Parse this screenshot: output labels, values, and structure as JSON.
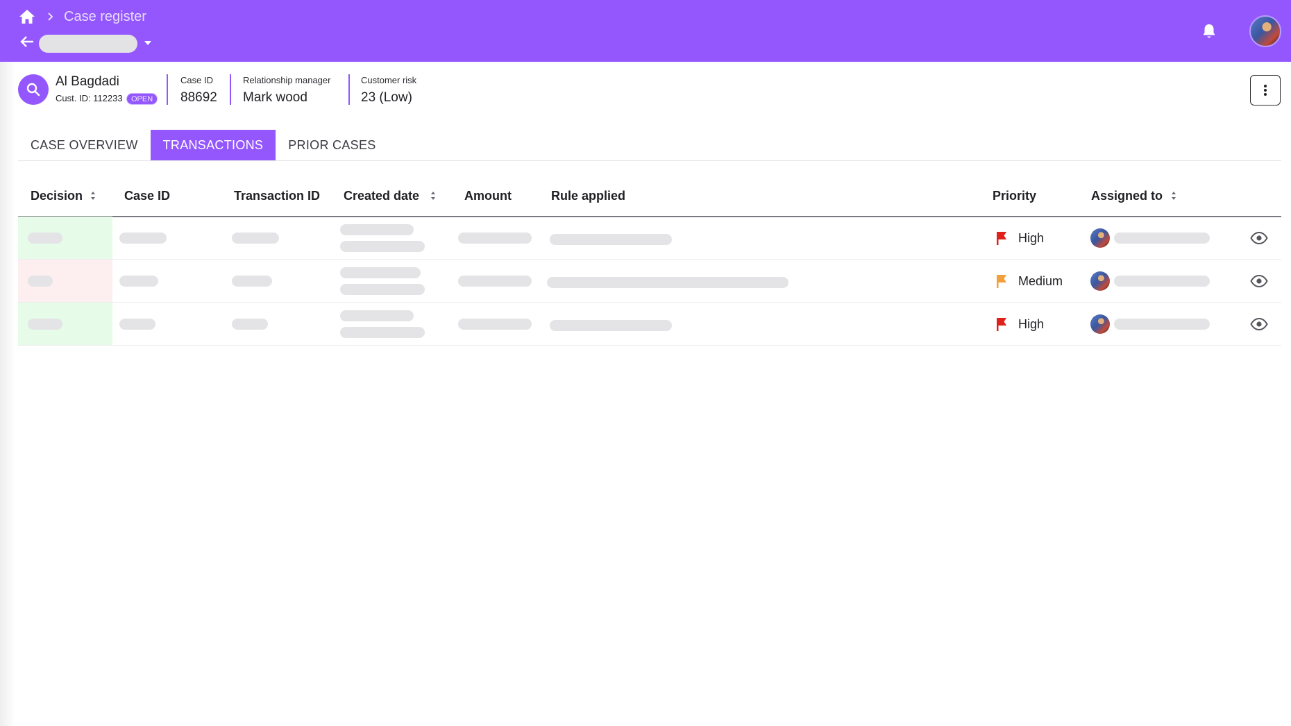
{
  "topbar": {
    "breadcrumb": "Case register",
    "icons": [
      "home-icon",
      "chevron-right-icon",
      "back-arrow-icon",
      "caret-down-icon",
      "bell-icon"
    ]
  },
  "case_header": {
    "customer_name": "Al Bagdadi",
    "customer_id_label": "Cust. ID: 112233",
    "status": "OPEN",
    "case_id_label": "Case ID",
    "case_id_value": "88692",
    "rm_label": "Relationship manager",
    "rm_value": "Mark wood",
    "risk_label": "Customer risk",
    "risk_value": "23 (Low)"
  },
  "tabs": [
    {
      "label": "CASE OVERVIEW",
      "active": false
    },
    {
      "label": "TRANSACTIONS",
      "active": true
    },
    {
      "label": "PRIOR CASES",
      "active": false
    }
  ],
  "table": {
    "columns": {
      "decision": "Decision",
      "case_id": "Case ID",
      "transaction_id": "Transaction ID",
      "created_date": "Created date",
      "amount": "Amount",
      "rule_applied": "Rule applied",
      "priority": "Priority",
      "assigned_to": "Assigned to"
    },
    "rows": [
      {
        "priority": "High",
        "priority_color": "#e0201b",
        "decision_color": "#e6fbe8"
      },
      {
        "priority": "Medium",
        "priority_color": "#f3a03b",
        "decision_color": "#fdeef0"
      },
      {
        "priority": "High",
        "priority_color": "#e0201b",
        "decision_color": "#e6fbe8"
      }
    ]
  },
  "colors": {
    "brand": "#9457fd",
    "skeleton": "#e4e4e7"
  }
}
